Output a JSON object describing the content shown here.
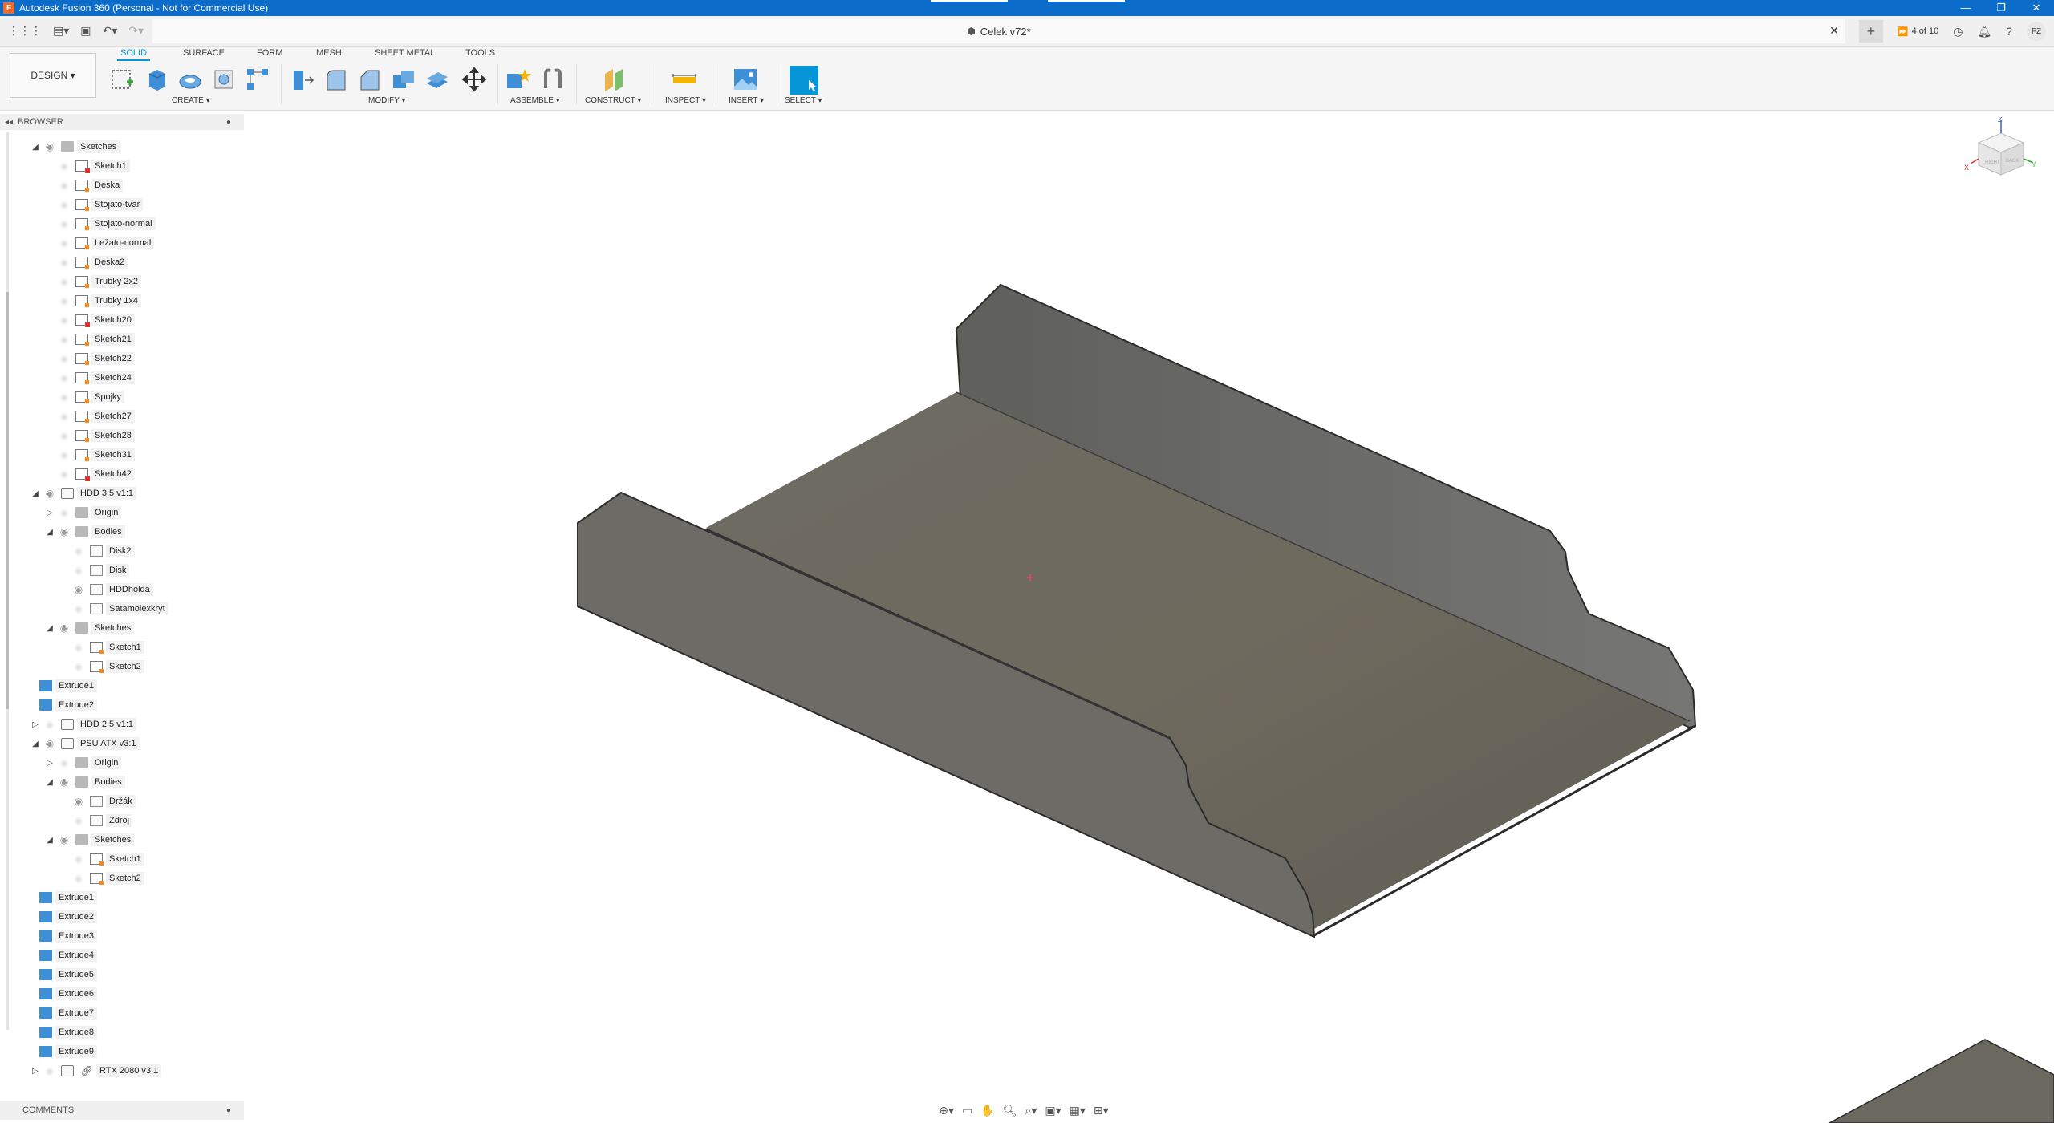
{
  "titlebar": {
    "title": "Autodesk Fusion 360 (Personal - Not for Commercial Use)",
    "controls": [
      "—",
      "❐",
      "✕"
    ]
  },
  "doc": {
    "name": "Celek v72*"
  },
  "header_right": {
    "jobs": "4 of 10",
    "user": "FZ"
  },
  "workspace": {
    "label": "DESIGN ▾"
  },
  "tabs": [
    "SOLID",
    "SURFACE",
    "FORM",
    "MESH",
    "SHEET METAL",
    "TOOLS"
  ],
  "groups": {
    "create": "CREATE ▾",
    "modify": "MODIFY ▾",
    "assemble": "ASSEMBLE ▾",
    "construct": "CONSTRUCT ▾",
    "inspect": "INSPECT ▾",
    "insert": "INSERT ▾",
    "select": "SELECT ▾"
  },
  "browser": {
    "title": "BROWSER",
    "rows": [
      {
        "label": "Sketches",
        "icon": "folder",
        "indent": 0,
        "arrow": "open",
        "eye": "on"
      },
      {
        "label": "Sketch1",
        "icon": "sketch-red",
        "indent": 1,
        "eye": "off"
      },
      {
        "label": "Deska",
        "icon": "sketch-orange",
        "indent": 1,
        "eye": "off"
      },
      {
        "label": "Stojato-tvar",
        "icon": "sketch-orange",
        "indent": 1,
        "eye": "off"
      },
      {
        "label": "Stojato-normal",
        "icon": "sketch-orange",
        "indent": 1,
        "eye": "off"
      },
      {
        "label": "Ležato-normal",
        "icon": "sketch-orange",
        "indent": 1,
        "eye": "off"
      },
      {
        "label": "Deska2",
        "icon": "sketch-orange",
        "indent": 1,
        "eye": "off"
      },
      {
        "label": "Trubky 2x2",
        "icon": "sketch-orange",
        "indent": 1,
        "eye": "off"
      },
      {
        "label": "Trubky 1x4",
        "icon": "sketch-orange",
        "indent": 1,
        "eye": "off"
      },
      {
        "label": "Sketch20",
        "icon": "sketch-red",
        "indent": 1,
        "eye": "off"
      },
      {
        "label": "Sketch21",
        "icon": "sketch-orange",
        "indent": 1,
        "eye": "off"
      },
      {
        "label": "Sketch22",
        "icon": "sketch-orange",
        "indent": 1,
        "eye": "off"
      },
      {
        "label": "Sketch24",
        "icon": "sketch-orange",
        "indent": 1,
        "eye": "off"
      },
      {
        "label": "Spojky",
        "icon": "sketch-orange",
        "indent": 1,
        "eye": "off"
      },
      {
        "label": "Sketch27",
        "icon": "sketch-orange",
        "indent": 1,
        "eye": "off"
      },
      {
        "label": "Sketch28",
        "icon": "sketch-orange",
        "indent": 1,
        "eye": "off"
      },
      {
        "label": "Sketch31",
        "icon": "sketch-orange",
        "indent": 1,
        "eye": "off"
      },
      {
        "label": "Sketch42",
        "icon": "sketch-red",
        "indent": 1,
        "eye": "off"
      },
      {
        "label": "HDD 3,5 v1:1",
        "icon": "comp",
        "indent": 0,
        "arrow": "open",
        "eye": "on"
      },
      {
        "label": "Origin",
        "icon": "folder",
        "indent": 1,
        "arrow": "closed",
        "eye": "off"
      },
      {
        "label": "Bodies",
        "icon": "folder",
        "indent": 1,
        "arrow": "open",
        "eye": "on"
      },
      {
        "label": "Disk2",
        "icon": "body",
        "indent": 2,
        "eye": "off"
      },
      {
        "label": "Disk",
        "icon": "body",
        "indent": 2,
        "eye": "off"
      },
      {
        "label": "HDDholda",
        "icon": "body",
        "indent": 2,
        "eye": "on"
      },
      {
        "label": "Satamolexkryt",
        "icon": "body",
        "indent": 2,
        "eye": "off"
      },
      {
        "label": "Sketches",
        "icon": "folder",
        "indent": 1,
        "arrow": "open",
        "eye": "on"
      },
      {
        "label": "Sketch1",
        "icon": "sketch-orange",
        "indent": 2,
        "eye": "off"
      },
      {
        "label": "Sketch2",
        "icon": "sketch-orange",
        "indent": 2,
        "eye": "off"
      },
      {
        "label": "Extrude1",
        "icon": "extrude",
        "indent": 0.5
      },
      {
        "label": "Extrude2",
        "icon": "extrude",
        "indent": 0.5
      },
      {
        "label": "HDD 2,5 v1:1",
        "icon": "comp",
        "indent": 0,
        "arrow": "closed",
        "eye": "off"
      },
      {
        "label": "PSU ATX v3:1",
        "icon": "comp",
        "indent": 0,
        "arrow": "open",
        "eye": "on"
      },
      {
        "label": "Origin",
        "icon": "folder",
        "indent": 1,
        "arrow": "closed",
        "eye": "off"
      },
      {
        "label": "Bodies",
        "icon": "folder",
        "indent": 1,
        "arrow": "open",
        "eye": "on"
      },
      {
        "label": "Držák",
        "icon": "body",
        "indent": 2,
        "eye": "on"
      },
      {
        "label": "Zdroj",
        "icon": "body",
        "indent": 2,
        "eye": "off"
      },
      {
        "label": "Sketches",
        "icon": "folder",
        "indent": 1,
        "arrow": "open",
        "eye": "on"
      },
      {
        "label": "Sketch1",
        "icon": "sketch-orange",
        "indent": 2,
        "eye": "off"
      },
      {
        "label": "Sketch2",
        "icon": "sketch-orange",
        "indent": 2,
        "eye": "off"
      },
      {
        "label": "Extrude1",
        "icon": "extrude",
        "indent": 0.5
      },
      {
        "label": "Extrude2",
        "icon": "extrude",
        "indent": 0.5
      },
      {
        "label": "Extrude3",
        "icon": "extrude",
        "indent": 0.5
      },
      {
        "label": "Extrude4",
        "icon": "extrude",
        "indent": 0.5
      },
      {
        "label": "Extrude5",
        "icon": "extrude",
        "indent": 0.5
      },
      {
        "label": "Extrude6",
        "icon": "extrude",
        "indent": 0.5
      },
      {
        "label": "Extrude7",
        "icon": "extrude",
        "indent": 0.5
      },
      {
        "label": "Extrude8",
        "icon": "extrude",
        "indent": 0.5
      },
      {
        "label": "Extrude9",
        "icon": "extrude",
        "indent": 0.5
      },
      {
        "label": "RTX 2080 v3:1",
        "icon": "comp-link",
        "indent": 0,
        "arrow": "closed",
        "eye": "off"
      }
    ]
  },
  "comments": {
    "title": "COMMENTS"
  },
  "viewcube": {
    "faces": [
      "FRONT",
      "RIGHT",
      "BACK"
    ],
    "axes": [
      "Z",
      "X",
      "Y"
    ]
  },
  "colors": {
    "titlebar": "#0b6cc9",
    "accent": "#0696d7",
    "model": "#6b6a62"
  }
}
